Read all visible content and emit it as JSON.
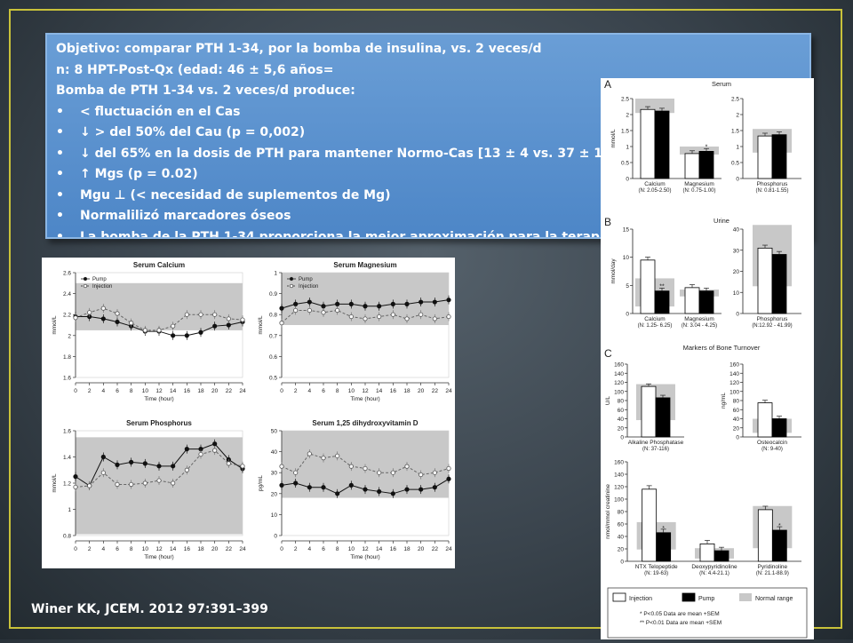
{
  "slide": {
    "text_lines": [
      "Objetivo: comparar PTH 1-34, por la bomba de insulina, vs. 2 veces/d",
      "n: 8 HPT-Post-Qx (edad: 46 ± 5,6 años=",
      "Bomba de PTH 1-34  vs. 2 veces/d produce:"
    ],
    "bullets": [
      "< fluctuación en el Cas",
      "↓ > del 50% del Cau (p = 0,002)",
      "↓ del 65% en la dosis de PTH para mantener Normo-Cas [13 ± 4 vs. 37 ± 1",
      "↑ Mgs (p = 0.02)",
      "Mgu ⊥ (< necesidad de suplementos de Mg)",
      "Normalilizó marcadores óseos",
      "La bomba de la PTH 1-34 proporciona la mejor aproximación para la terapi"
    ],
    "citation": "Winer KK, JCEM. 2012 97:391–399"
  },
  "colors": {
    "frame": "#c9c23a",
    "textbox": "#5b93d0",
    "text": "#ffffff",
    "normal_range": "#c8c8c8"
  },
  "chart_data": [
    {
      "type": "line",
      "title": "Serum Calcium",
      "xlabel": "Time (hour)",
      "ylabel": "mmol/L",
      "x": [
        0,
        2,
        4,
        6,
        8,
        10,
        12,
        14,
        16,
        18,
        20,
        22,
        24
      ],
      "xlim": [
        0,
        24
      ],
      "ylim": [
        1.6,
        2.6
      ],
      "yticks": [
        1.6,
        1.8,
        2.0,
        2.2,
        2.4,
        2.6
      ],
      "normal_band": [
        2.05,
        2.5
      ],
      "legend": [
        "Pump",
        "Injection"
      ],
      "series": [
        {
          "name": "Pump",
          "values": [
            2.18,
            2.18,
            2.16,
            2.13,
            2.09,
            2.04,
            2.04,
            2.0,
            2.0,
            2.03,
            2.09,
            2.1,
            2.13
          ]
        },
        {
          "name": "Injection",
          "values": [
            2.17,
            2.22,
            2.26,
            2.21,
            2.12,
            2.05,
            2.05,
            2.09,
            2.2,
            2.2,
            2.2,
            2.16,
            2.15
          ]
        }
      ]
    },
    {
      "type": "line",
      "title": "Serum Magnesium",
      "xlabel": "Time (hour)",
      "ylabel": "mmol/L",
      "x": [
        0,
        2,
        4,
        6,
        8,
        10,
        12,
        14,
        16,
        18,
        20,
        22,
        24
      ],
      "xlim": [
        0,
        24
      ],
      "ylim": [
        0.5,
        1.0
      ],
      "yticks": [
        0.5,
        0.6,
        0.7,
        0.8,
        0.9,
        1.0
      ],
      "normal_band": [
        0.75,
        1.0
      ],
      "legend": [
        "Pump",
        "Injection"
      ],
      "series": [
        {
          "name": "Pump",
          "values": [
            0.83,
            0.85,
            0.86,
            0.84,
            0.85,
            0.85,
            0.84,
            0.84,
            0.85,
            0.85,
            0.86,
            0.86,
            0.87
          ]
        },
        {
          "name": "Injection",
          "values": [
            0.76,
            0.82,
            0.82,
            0.81,
            0.82,
            0.79,
            0.78,
            0.79,
            0.8,
            0.78,
            0.8,
            0.78,
            0.79
          ]
        }
      ]
    },
    {
      "type": "line",
      "title": "Serum Phosphorus",
      "xlabel": "Time (hour)",
      "ylabel": "mmol/L",
      "x": [
        0,
        2,
        4,
        6,
        8,
        10,
        12,
        14,
        16,
        18,
        20,
        22,
        24
      ],
      "xlim": [
        0,
        24
      ],
      "ylim": [
        0.8,
        1.6
      ],
      "yticks": [
        0.8,
        1.0,
        1.2,
        1.4,
        1.6
      ],
      "normal_band": [
        0.81,
        1.55
      ],
      "series": [
        {
          "name": "Pump",
          "values": [
            1.25,
            1.18,
            1.4,
            1.34,
            1.36,
            1.35,
            1.33,
            1.33,
            1.46,
            1.46,
            1.5,
            1.38,
            1.31
          ]
        },
        {
          "name": "Injection",
          "values": [
            1.17,
            1.18,
            1.28,
            1.19,
            1.19,
            1.2,
            1.22,
            1.2,
            1.3,
            1.42,
            1.45,
            1.35,
            1.33
          ]
        }
      ]
    },
    {
      "type": "line",
      "title": "Serum 1,25 dihydroxyvitamin D",
      "xlabel": "Time (hour)",
      "ylabel": "pg/mL",
      "x": [
        0,
        2,
        4,
        6,
        8,
        10,
        12,
        14,
        16,
        18,
        20,
        22,
        24
      ],
      "xlim": [
        0,
        24
      ],
      "ylim": [
        0,
        50
      ],
      "yticks": [
        0,
        10,
        20,
        30,
        40,
        50
      ],
      "normal_band": [
        18,
        50
      ],
      "series": [
        {
          "name": "Pump",
          "values": [
            24,
            25,
            23,
            23,
            20,
            24,
            22,
            21,
            20,
            22,
            22,
            23,
            27
          ]
        },
        {
          "name": "Injection",
          "values": [
            33,
            30,
            39,
            37,
            38,
            33,
            32,
            30,
            30,
            33,
            29,
            30,
            32
          ]
        }
      ]
    },
    {
      "type": "bar",
      "panel": "A",
      "title": "Serum",
      "ylabel": "mmol/L",
      "ylim": [
        0,
        2.5
      ],
      "yticks": [
        0,
        0.5,
        1,
        1.5,
        2,
        2.5
      ],
      "categories": [
        "Calcium",
        "Magnesium"
      ],
      "category_ranges": [
        "(N: 2.05-2.50)",
        "(N: 0.75-1.00)"
      ],
      "normal_ranges": [
        [
          2.05,
          2.5
        ],
        [
          0.75,
          1.0
        ]
      ],
      "series": [
        {
          "name": "Injection",
          "values": [
            2.16,
            0.78
          ]
        },
        {
          "name": "Pump",
          "values": [
            2.11,
            0.85
          ]
        }
      ],
      "annotations": [
        "",
        "*"
      ]
    },
    {
      "type": "bar",
      "panel": "A",
      "ylim": [
        0,
        2.5
      ],
      "yticks": [
        0,
        0.5,
        1,
        1.5,
        2,
        2.5
      ],
      "categories": [
        "Phosphorus"
      ],
      "category_ranges": [
        "(N: 0.81-1.55)"
      ],
      "normal_ranges": [
        [
          0.81,
          1.55
        ]
      ],
      "series": [
        {
          "name": "Injection",
          "values": [
            1.33
          ]
        },
        {
          "name": "Pump",
          "values": [
            1.37
          ]
        }
      ]
    },
    {
      "type": "bar",
      "panel": "B",
      "title": "Urine",
      "ylabel": "mmol/day",
      "ylim": [
        0,
        15
      ],
      "yticks": [
        0,
        5,
        10,
        15
      ],
      "categories": [
        "Calcium",
        "Magnesium"
      ],
      "category_ranges": [
        "(N: 1.25- 6.25)",
        "(N: 3.04 - 4.25)"
      ],
      "normal_ranges": [
        [
          1.25,
          6.25
        ],
        [
          3.04,
          4.25
        ]
      ],
      "series": [
        {
          "name": "Injection",
          "values": [
            9.5,
            4.6
          ]
        },
        {
          "name": "Pump",
          "values": [
            4.0,
            4.0
          ]
        }
      ],
      "annotations": [
        "**",
        ""
      ]
    },
    {
      "type": "bar",
      "panel": "B",
      "ylim": [
        0,
        40
      ],
      "yticks": [
        0,
        10,
        20,
        30,
        40
      ],
      "categories": [
        "Phosphorus"
      ],
      "category_ranges": [
        "(N:12.92 - 41.99)"
      ],
      "normal_ranges": [
        [
          12.92,
          41.99
        ]
      ],
      "series": [
        {
          "name": "Injection",
          "values": [
            31
          ]
        },
        {
          "name": "Pump",
          "values": [
            28
          ]
        }
      ]
    },
    {
      "type": "bar",
      "panel": "C",
      "title": "Markers of Bone Turnover",
      "ylabel": "U/L",
      "ylim": [
        0,
        160
      ],
      "yticks": [
        0,
        20,
        40,
        60,
        80,
        100,
        120,
        140,
        160
      ],
      "categories": [
        "Alkaline Phosphatase"
      ],
      "category_ranges": [
        "(N: 37-116)"
      ],
      "normal_ranges": [
        [
          37,
          116
        ]
      ],
      "series": [
        {
          "name": "Injection",
          "values": [
            111
          ]
        },
        {
          "name": "Pump",
          "values": [
            86
          ]
        }
      ]
    },
    {
      "type": "bar",
      "panel": "C",
      "ylabel": "ng/mL",
      "ylim": [
        0,
        160
      ],
      "yticks": [
        0,
        20,
        40,
        60,
        80,
        100,
        120,
        140,
        160
      ],
      "categories": [
        "Osteocalcin"
      ],
      "category_ranges": [
        "(N: 9-40)"
      ],
      "normal_ranges": [
        [
          9,
          40
        ]
      ],
      "series": [
        {
          "name": "Injection",
          "values": [
            75
          ]
        },
        {
          "name": "Pump",
          "values": [
            40
          ]
        }
      ]
    },
    {
      "type": "bar",
      "panel": "C",
      "ylabel": "nmol/mmol creatinine",
      "ylim": [
        0,
        160
      ],
      "yticks": [
        0,
        20,
        40,
        60,
        80,
        100,
        120,
        140,
        160
      ],
      "categories": [
        "NTX Telopeptide",
        "Deoxypyridinoline",
        "Pyridinoline"
      ],
      "category_ranges": [
        "(N: 19-63)",
        "(N: 4.4-21.1)",
        "(N: 21.1-88.9)"
      ],
      "normal_ranges": [
        [
          19,
          63
        ],
        [
          4.4,
          21.1
        ],
        [
          21.1,
          88.9
        ]
      ],
      "series": [
        {
          "name": "Injection",
          "values": [
            116,
            28,
            83
          ]
        },
        {
          "name": "Pump",
          "values": [
            46,
            17,
            50
          ]
        }
      ],
      "annotations": [
        "*",
        "",
        "*"
      ]
    }
  ],
  "bar_legend": {
    "items": [
      "Injection",
      "Pump",
      "Normal range"
    ],
    "notes": [
      "* P<0.05 Data are mean +SEM",
      "** P<0.01 Data are mean +SEM"
    ]
  }
}
